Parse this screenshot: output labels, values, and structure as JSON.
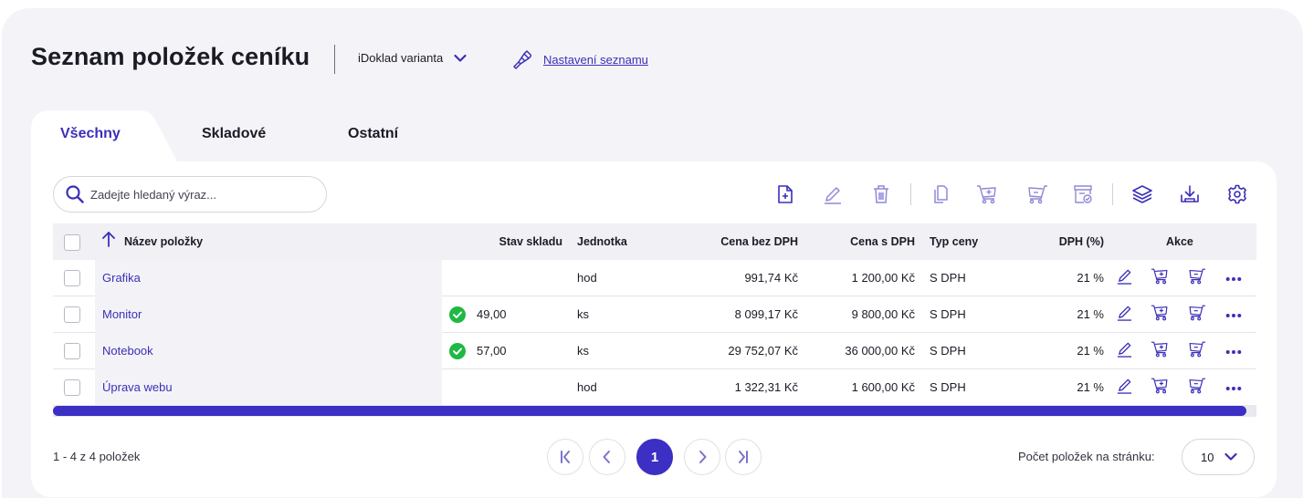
{
  "header": {
    "title": "Seznam položek ceníku",
    "variant_label": "iDoklad varianta",
    "settings_link": "Nastavení seznamu"
  },
  "tabs": [
    {
      "label": "Všechny",
      "active": true
    },
    {
      "label": "Skladové",
      "active": false
    },
    {
      "label": "Ostatní",
      "active": false
    }
  ],
  "search": {
    "placeholder": "Zadejte hledaný výraz..."
  },
  "toolbar": {
    "icons": [
      "add-item-icon",
      "edit-icon",
      "delete-icon",
      "copy-icon",
      "cart-add-icon",
      "cart-remove-icon",
      "stock-check-icon",
      "layers-icon",
      "download-icon",
      "settings-gear-icon"
    ]
  },
  "table": {
    "columns": {
      "name": "Název položky",
      "stock": "Stav skladu",
      "unit": "Jednotka",
      "price_net": "Cena bez DPH",
      "price_gross": "Cena s DPH",
      "price_type": "Typ ceny",
      "vat": "DPH (%)",
      "actions": "Akce"
    },
    "rows": [
      {
        "name": "Grafika",
        "stock": "",
        "unit": "hod",
        "price_net": "991,74 Kč",
        "price_gross": "1 200,00 Kč",
        "price_type": "S DPH",
        "vat": "21 %"
      },
      {
        "name": "Monitor",
        "stock": "49,00",
        "unit": "ks",
        "price_net": "8 099,17 Kč",
        "price_gross": "9 800,00 Kč",
        "price_type": "S DPH",
        "vat": "21 %"
      },
      {
        "name": "Notebook",
        "stock": "57,00",
        "unit": "ks",
        "price_net": "29 752,07 Kč",
        "price_gross": "36 000,00 Kč",
        "price_type": "S DPH",
        "vat": "21 %"
      },
      {
        "name": "Úprava webu",
        "stock": "",
        "unit": "hod",
        "price_net": "1 322,31 Kč",
        "price_gross": "1 600,00 Kč",
        "price_type": "S DPH",
        "vat": "21 %"
      }
    ]
  },
  "footer": {
    "count_text": "1 - 4 z 4 položek",
    "current_page": "1",
    "per_page_label": "Počet položek na stránku:",
    "per_page_value": "10"
  },
  "colors": {
    "accent": "#3b2fc4",
    "link": "#3b2fb8",
    "ok": "#1fb843"
  }
}
